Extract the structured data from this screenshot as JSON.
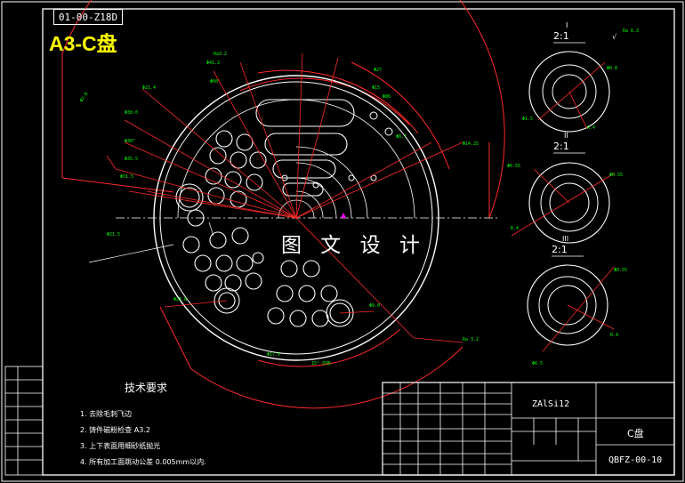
{
  "drawing": {
    "code_box": "01-00-Z18D",
    "badge": "A3-C盘",
    "watermark": "图 文 设 计",
    "tech_requirements": {
      "title": "技术要求",
      "items": [
        "1. 去除毛刺飞边",
        "2. 铸件磁粉检查 A3.2",
        "3. 上下表面用细砂纸抛光",
        "4. 所有加工面跳动公差 0.005mm以内."
      ]
    },
    "detail_views": [
      {
        "scale": "2:1",
        "mark": "I"
      },
      {
        "scale": "2:1",
        "mark": "II"
      },
      {
        "scale": "2:1",
        "mark": "III"
      }
    ],
    "title_block": {
      "material": "ZAlSi12",
      "part_name": "C盘",
      "drawing_number": "QBFZ-00-10"
    },
    "colors": {
      "background": "#000000",
      "frame": "#ffffff",
      "dimension": "#ff2a2a",
      "annotation": "#00ff00",
      "badge": "#ffff00",
      "center_mark": "#ff00ff"
    }
  }
}
